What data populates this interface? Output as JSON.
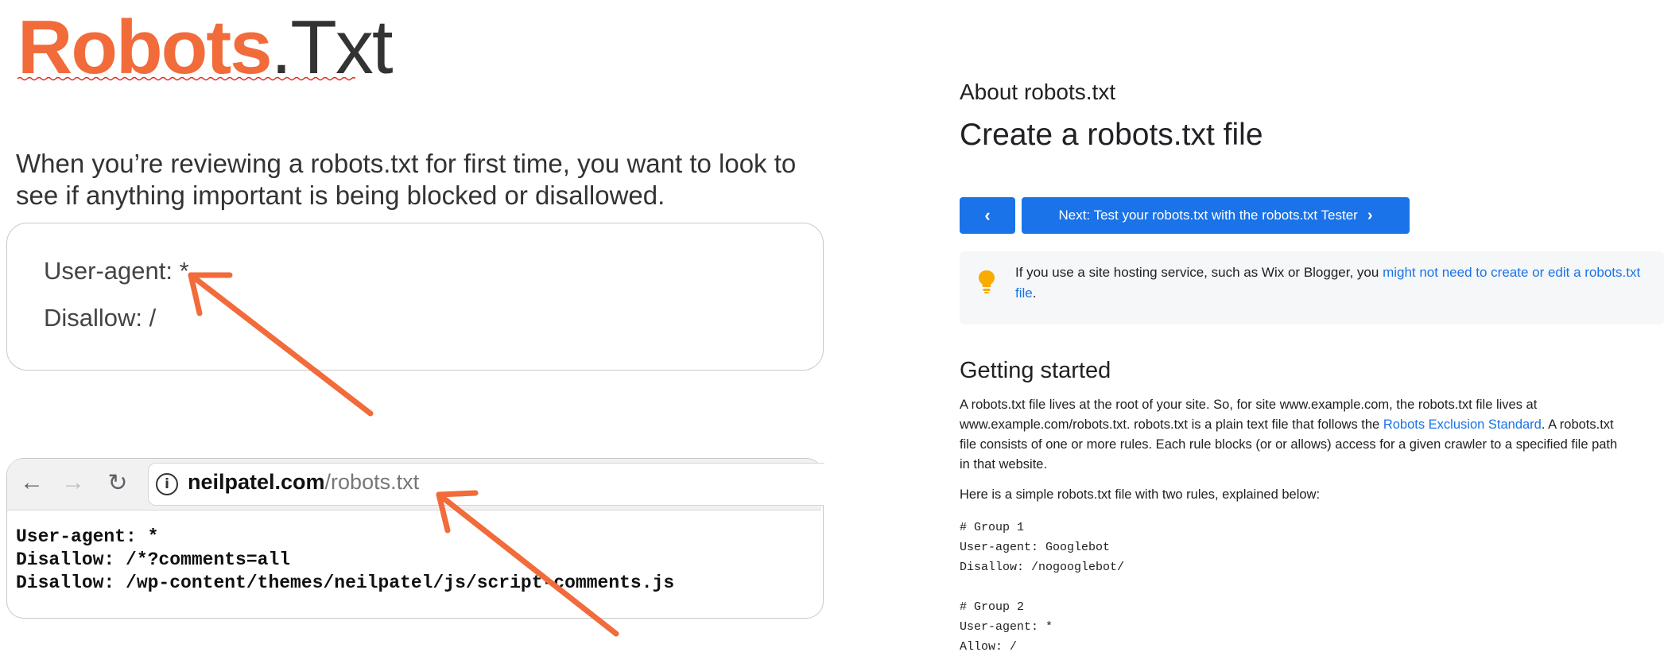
{
  "slide": {
    "title_bold": "Robots",
    "title_light": ".Txt",
    "intro": "When you’re reviewing a robots.txt for first time, you want to look to see if anything important is being blocked or disallowed.",
    "card_lines": [
      "User-agent: *",
      "Disallow: /"
    ]
  },
  "browser": {
    "url_domain": "neilpatel.com",
    "url_path": "/robots.txt",
    "content_lines": [
      "User-agent: *",
      "Disallow: /*?comments=all",
      "Disallow: /wp-content/themes/neilpatel/js/script-comments.js"
    ]
  },
  "docs": {
    "breadcrumb": "About robots.txt",
    "title": "Create a robots.txt file",
    "prev_button": "‹",
    "next_button": "Next: Test your robots.txt with the robots.txt Tester",
    "tip_text": "If you use a site hosting service, such as Wix or Blogger, you ",
    "tip_link": "might not need to create or edit a robots.txt file",
    "tip_end": ".",
    "section_title": "Getting started",
    "para1_a": "A robots.txt file lives at the root of your site. So, for site www.example.com, the robots.txt file lives at www.example.com/robots.txt. robots.txt is a plain text file that follows the ",
    "para1_link": "Robots Exclusion Standard",
    "para1_b": ". A robots.txt file consists of one or more rules. Each rule blocks (or or allows) access for a given crawler to a specified file path in that website.",
    "para2": "Here is a simple robots.txt file with two rules, explained below:",
    "code": [
      "# Group 1",
      "User-agent: Googlebot",
      "Disallow: /nogooglebot/",
      "",
      "# Group 2",
      "User-agent: *",
      "Allow: /"
    ]
  },
  "colors": {
    "accent_orange": "#f26b3a",
    "link_blue": "#1a73e8",
    "bulb_yellow": "#f9ab00"
  },
  "icons": [
    "back-arrow-icon",
    "forward-arrow-icon",
    "reload-icon",
    "info-icon",
    "chevron-left-icon",
    "chevron-right-icon",
    "lightbulb-icon",
    "annotation-arrow"
  ]
}
